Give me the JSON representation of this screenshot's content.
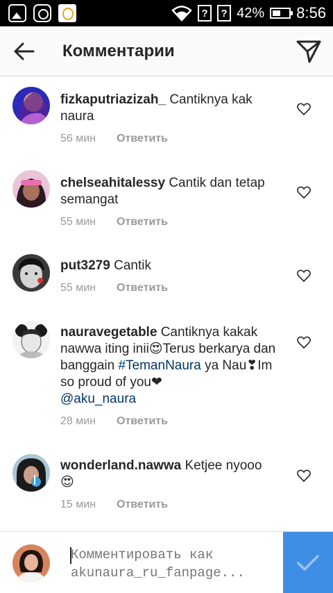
{
  "status_bar": {
    "icons": [
      "gallery-icon",
      "instagram-icon",
      "app-icon",
      "wifi-icon",
      "sim1-icon",
      "sim2-icon"
    ],
    "sim_label": "?",
    "battery": "42%",
    "time": "8:56"
  },
  "header": {
    "title": "Комментарии",
    "back_icon": "arrow-left-icon",
    "send_icon": "send-icon"
  },
  "comments": [
    {
      "username": "fizkaputriazizah_",
      "text": "Cantiknya kak naura",
      "time": "56 мин",
      "reply": "Ответить"
    },
    {
      "username": "chelseahitalessy",
      "text": "Cantik dan tetap semangat",
      "time": "55 мин",
      "reply": "Ответить"
    },
    {
      "username": "put3279",
      "text": "Cantik",
      "time": "55 мин",
      "reply": "Ответить"
    },
    {
      "username": "nauravegetable",
      "text_1": "Cantiknya kakak nawwa iting inii",
      "emoji_1": "😍",
      "text_2": "Terus berkarya dan banggain ",
      "hashtag": "#TemanNaura",
      "text_3": " ya Nau",
      "emoji_2": "❣",
      "text_4": "Im so proud of you",
      "emoji_3": "❤",
      "mention": "@aku_naura",
      "time": "28 мин",
      "reply": "Ответить"
    },
    {
      "username": "wonderland.nawwa",
      "text": "Ketjee nyooo",
      "emoji": "😍",
      "time": "15 мин",
      "reply": "Ответить"
    }
  ],
  "composer": {
    "placeholder": "Комментировать как akunaura_ru_fanpage...",
    "submit_icon": "checkmark-icon"
  },
  "colors": {
    "accent": "#3f8ee6",
    "hashtag": "#003569",
    "meta": "#999999",
    "status_bar": "#000000"
  }
}
